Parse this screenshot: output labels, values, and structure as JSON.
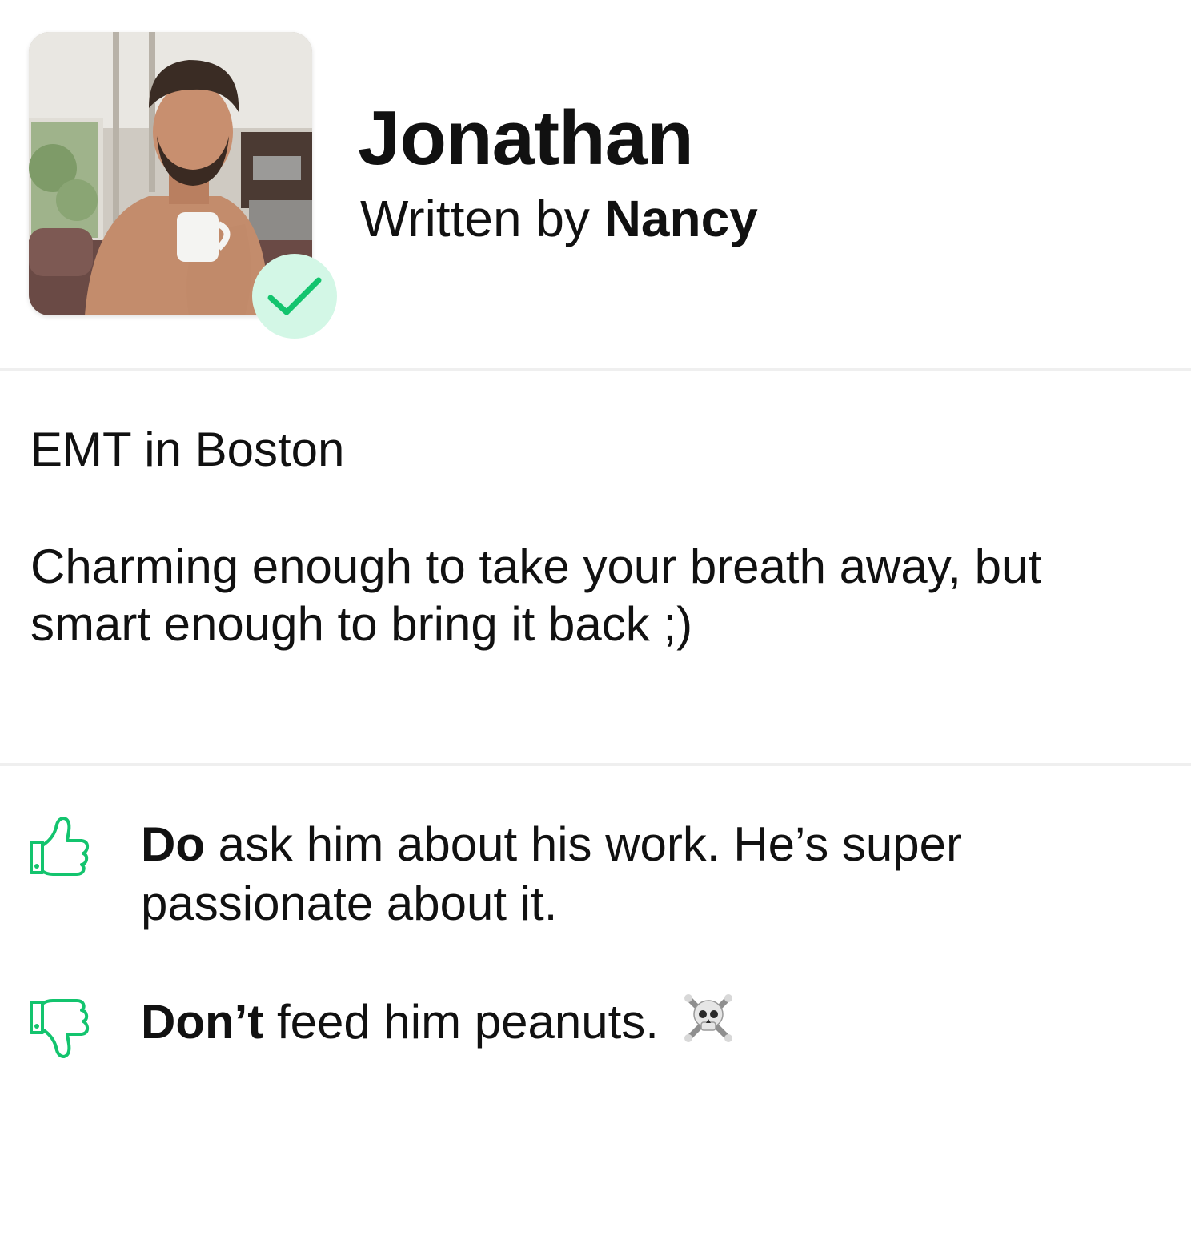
{
  "profile": {
    "name": "Jonathan",
    "byline_prefix": "Written by",
    "author": "Nancy",
    "verified": true,
    "photo_description_icon": "profile-photo"
  },
  "about": {
    "tagline": "EMT in Boston",
    "bio": "Charming enough to take your breath away, but smart enough to bring it back ;)"
  },
  "tips": {
    "do": {
      "icon": "thumbs-up-icon",
      "label": "Do",
      "text": "ask him about his work. He’s super passionate about it."
    },
    "dont": {
      "icon": "thumbs-down-icon",
      "label": "Don’t",
      "text": "feed him peanuts.",
      "emoji": "skull-and-crossbones"
    }
  },
  "colors": {
    "accent": "#13c46e",
    "badge_bg": "#d3f7e6",
    "divider": "#efefef",
    "text": "#111111"
  }
}
